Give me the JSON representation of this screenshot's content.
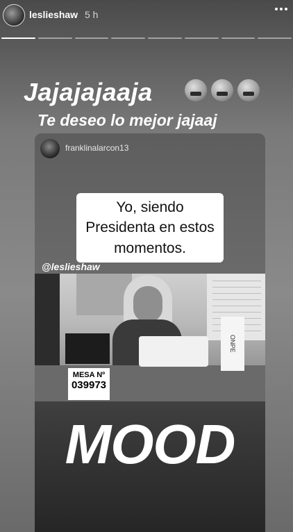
{
  "header": {
    "username": "leslieshaw",
    "time": "5 h",
    "avatar_icon": "profile-avatar",
    "more_icon": "more-options-icon"
  },
  "progress": {
    "segments": 8,
    "completed": 1
  },
  "captions": {
    "line1": "Jajajajaaja",
    "line1_emojis": [
      "grimacing-face",
      "rolling-on-floor-laughing",
      "grinning-sweat"
    ],
    "line2": "Te deseo lo mejor jajaaj"
  },
  "post": {
    "author": "franklinalarcon13",
    "quote": "Yo, siendo Presidenta en estos momentos.",
    "mention": "@leslieshaw",
    "mesa_label": "MESA Nº",
    "mesa_number": "039973",
    "onpe": "ONPE",
    "mood": "MOOD"
  },
  "colors": {
    "background": "#6e6e6e",
    "text": "#ffffff"
  }
}
